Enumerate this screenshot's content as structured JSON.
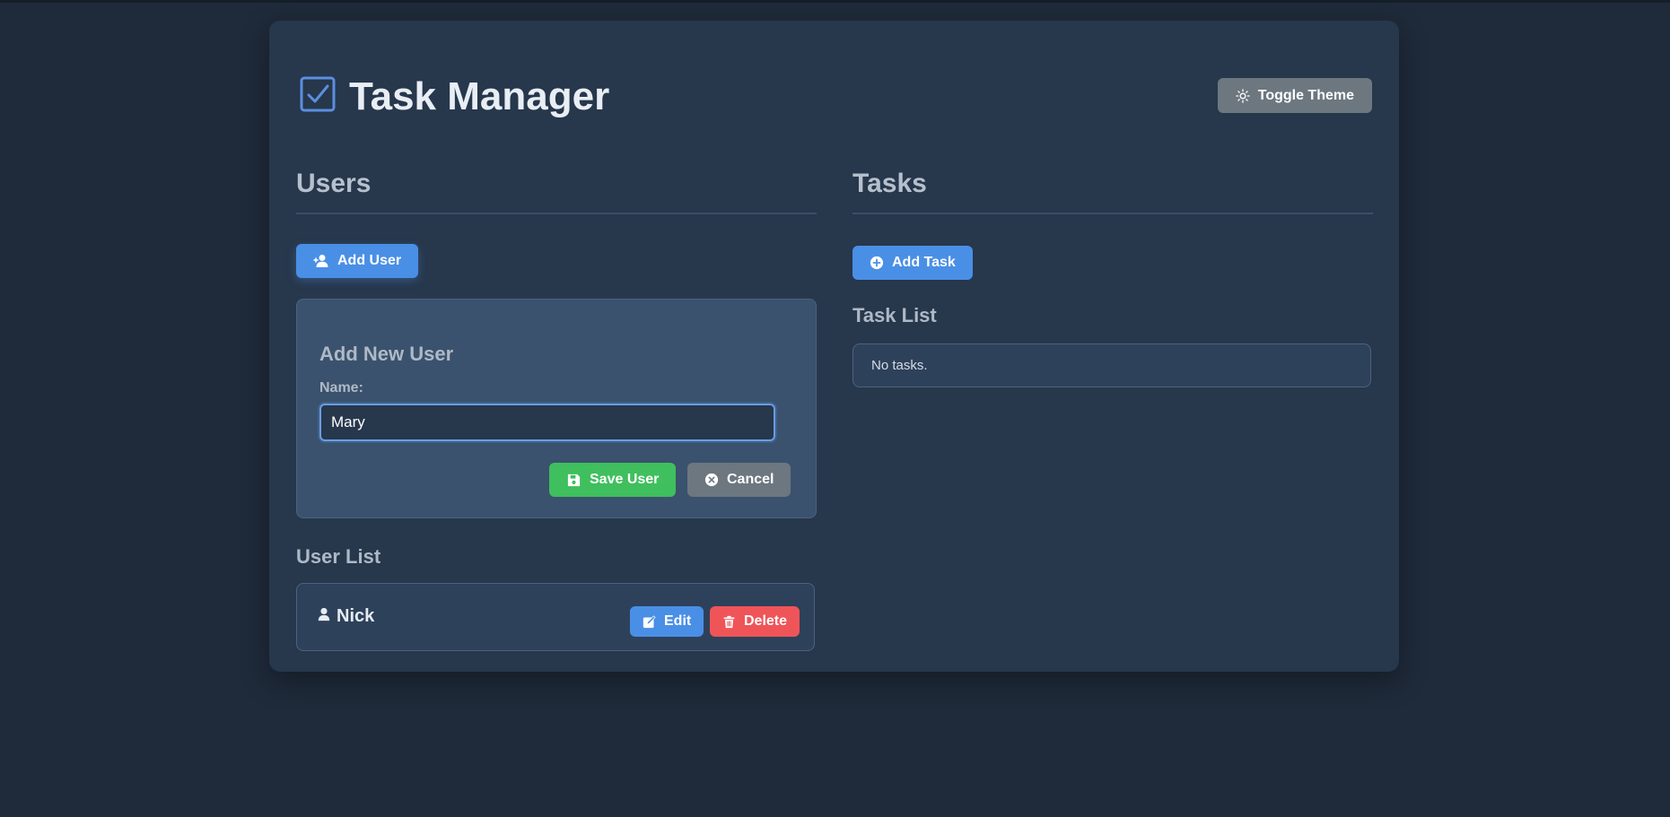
{
  "app": {
    "title": "Task Manager",
    "theme_button": "Toggle Theme",
    "logo_icon": "checkbox-check-icon"
  },
  "users": {
    "section_title": "Users",
    "add_button": "Add User",
    "form": {
      "title": "Add New User",
      "name_label": "Name:",
      "name_value": "Mary",
      "save_button": "Save User",
      "cancel_button": "Cancel"
    },
    "list_title": "User List",
    "items": [
      {
        "name": "Nick",
        "edit_label": "Edit",
        "delete_label": "Delete"
      }
    ]
  },
  "tasks": {
    "section_title": "Tasks",
    "add_button": "Add Task",
    "list_title": "Task List",
    "empty_text": "No tasks."
  },
  "colors": {
    "page_bg": "#1f2a3a",
    "card_bg": "#27374c",
    "primary": "#4a8fe6",
    "success": "#3fbf5d",
    "danger": "#ef5458",
    "neutral": "#6c7780"
  }
}
